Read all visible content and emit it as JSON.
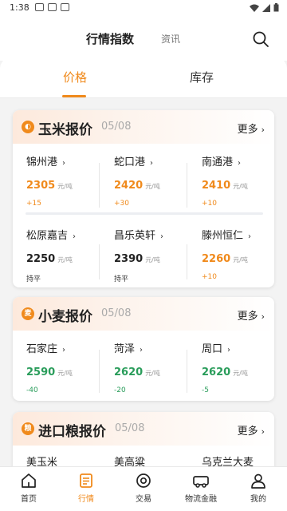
{
  "status_bar": {
    "time": "1:38",
    "icons": [
      "signal-icon",
      "sim-icon",
      "a-icon"
    ]
  },
  "header": {
    "title": "行情指数",
    "secondary": "资讯"
  },
  "tabs": [
    {
      "label": "价格",
      "active": true
    },
    {
      "label": "库存",
      "active": false
    }
  ],
  "colors": {
    "accent": "#f08a1c",
    "rise": "#f08a1c",
    "fall": "#2a9d5b"
  },
  "cards": [
    {
      "title": "玉米报价",
      "date": "05/08",
      "more": "更多",
      "icon": "corn-icon",
      "items": [
        {
          "name": "锦州港",
          "price": "2305",
          "unit": "元/吨",
          "change": "+15",
          "trend": "up"
        },
        {
          "name": "蛇口港",
          "price": "2420",
          "unit": "元/吨",
          "change": "+30",
          "trend": "up"
        },
        {
          "name": "南通港",
          "price": "2410",
          "unit": "元/吨",
          "change": "+10",
          "trend": "up"
        },
        {
          "name": "松原嘉吉",
          "price": "2250",
          "unit": "元/吨",
          "change": "持平",
          "trend": "flat"
        },
        {
          "name": "昌乐英轩",
          "price": "2390",
          "unit": "元/吨",
          "change": "持平",
          "trend": "flat"
        },
        {
          "name": "滕州恒仁",
          "price": "2260",
          "unit": "元/吨",
          "change": "+10",
          "trend": "up"
        }
      ]
    },
    {
      "title": "小麦报价",
      "date": "05/08",
      "more": "更多",
      "icon": "wheat-icon",
      "items": [
        {
          "name": "石家庄",
          "price": "2590",
          "unit": "元/吨",
          "change": "-40",
          "trend": "down"
        },
        {
          "name": "菏泽",
          "price": "2620",
          "unit": "元/吨",
          "change": "-20",
          "trend": "down"
        },
        {
          "name": "周口",
          "price": "2620",
          "unit": "元/吨",
          "change": "-5",
          "trend": "down"
        }
      ]
    },
    {
      "title": "进口粮报价",
      "date": "05/08",
      "more": "更多",
      "icon": "grain-icon",
      "items": [
        {
          "name": "美玉米"
        },
        {
          "name": "美高粱"
        },
        {
          "name": "乌克兰大麦"
        }
      ]
    }
  ],
  "bottom_nav": [
    {
      "label": "首页",
      "icon": "home-icon",
      "active": false
    },
    {
      "label": "行情",
      "icon": "market-icon",
      "active": true
    },
    {
      "label": "交易",
      "icon": "trade-icon",
      "active": false
    },
    {
      "label": "物流金融",
      "icon": "truck-icon",
      "active": false
    },
    {
      "label": "我的",
      "icon": "profile-icon",
      "active": false
    }
  ]
}
